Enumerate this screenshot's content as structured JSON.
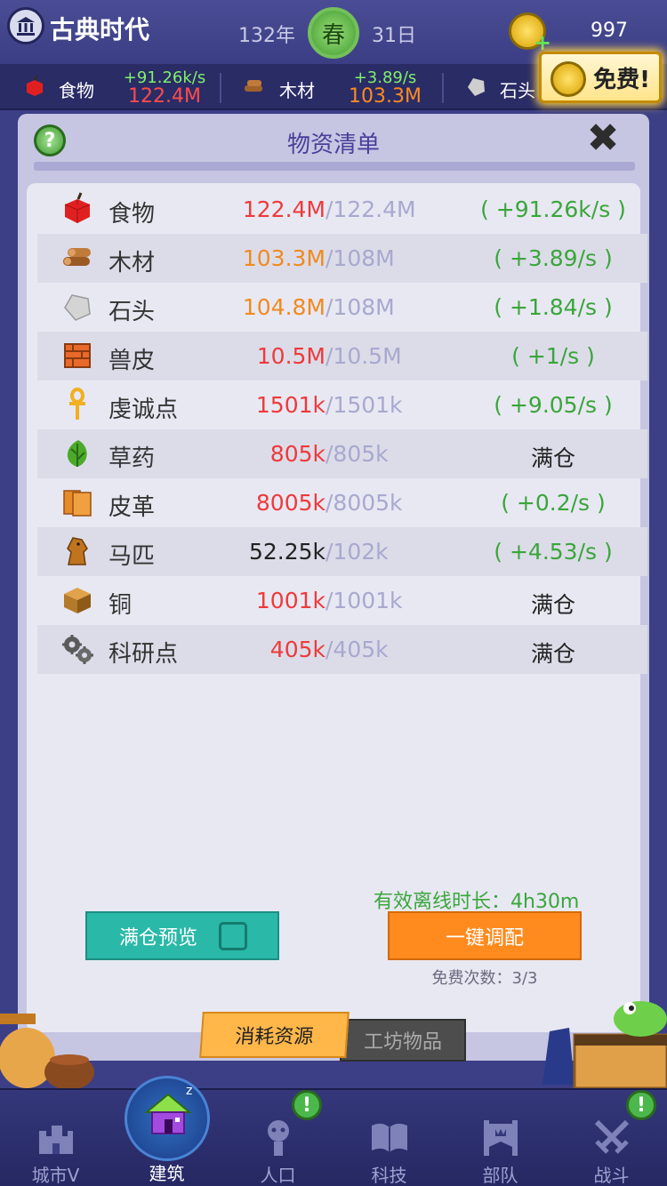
{
  "header": {
    "era_title": "古典时代",
    "year": "132年",
    "season": "春",
    "day": "31日",
    "coins": "997"
  },
  "resource_strip": [
    {
      "name": "食物",
      "rate": "+91.26k/s",
      "amount": "122.4M",
      "icon": "apple-icon"
    },
    {
      "name": "木材",
      "rate": "+3.89/s",
      "amount": "103.3M",
      "icon": "logs-icon"
    },
    {
      "name": "石头",
      "rate": "",
      "amount": "",
      "icon": "stone-icon"
    }
  ],
  "free_button": {
    "label": "免费!"
  },
  "panel": {
    "title": "物资清单",
    "help_label": "?",
    "close_label": "✖",
    "rows": [
      {
        "name": "食物",
        "current": "122.4M",
        "cap": "/122.4M",
        "rate": "( +91.26k/s )",
        "current_color": "#ee3a3a",
        "icon": "apple-icon"
      },
      {
        "name": "木材",
        "current": "103.3M",
        "cap": "/108M",
        "rate": "( +3.89/s )",
        "current_color": "#f08a1e",
        "icon": "logs-icon"
      },
      {
        "name": "石头",
        "current": "104.8M",
        "cap": "/108M",
        "rate": "( +1.84/s )",
        "current_color": "#f08a1e",
        "icon": "stone-icon"
      },
      {
        "name": "兽皮",
        "current": "10.5M",
        "cap": "/10.5M",
        "rate": "( +1/s )",
        "current_color": "#ee3a3a",
        "icon": "hide-icon"
      },
      {
        "name": "虔诚点",
        "current": "1501k",
        "cap": "/1501k",
        "rate": "( +9.05/s )",
        "current_color": "#ee3a3a",
        "icon": "ankh-icon"
      },
      {
        "name": "草药",
        "current": "805k",
        "cap": "/805k",
        "rate": "满仓",
        "current_color": "#ee3a3a",
        "icon": "herb-icon"
      },
      {
        "name": "皮革",
        "current": "8005k",
        "cap": "/8005k",
        "rate": "( +0.2/s )",
        "current_color": "#ee3a3a",
        "icon": "leather-icon"
      },
      {
        "name": "马匹",
        "current": "52.25k",
        "cap": "/102k",
        "rate": "( +4.53/s )",
        "current_color": "#222222",
        "icon": "horse-icon"
      },
      {
        "name": "铜",
        "current": "1001k",
        "cap": "/1001k",
        "rate": "满仓",
        "current_color": "#ee3a3a",
        "icon": "copper-icon"
      },
      {
        "name": "科研点",
        "current": "405k",
        "cap": "/405k",
        "rate": "满仓",
        "current_color": "#ee3a3a",
        "icon": "gears-icon"
      }
    ],
    "offline_label": "有效离线时长：4h30m",
    "preview_label": "满仓预览",
    "dispatch_label": "一键调配",
    "free_count": "免费次数：3/3"
  },
  "tabs": {
    "consume": "消耗资源",
    "workshop": "工坊物品"
  },
  "nav": [
    {
      "label": "城市V",
      "icon": "city-icon"
    },
    {
      "label": "建筑",
      "icon": "house-icon"
    },
    {
      "label": "人口",
      "icon": "person-icon"
    },
    {
      "label": "科技",
      "icon": "book-icon"
    },
    {
      "label": "部队",
      "icon": "banner-icon"
    },
    {
      "label": "战斗",
      "icon": "swords-icon"
    }
  ],
  "badges": [
    "!",
    "!"
  ]
}
